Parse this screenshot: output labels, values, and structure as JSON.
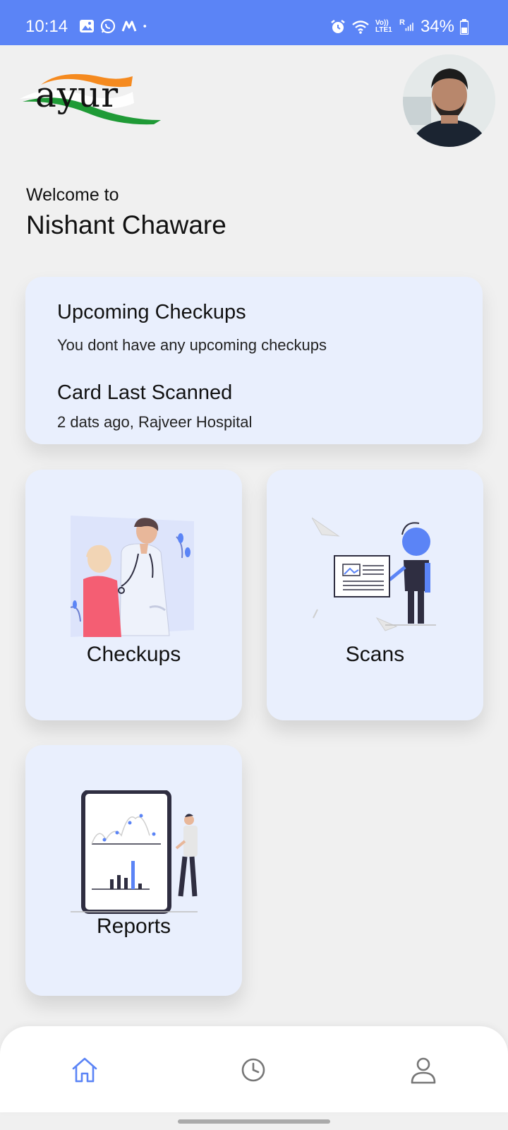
{
  "status_bar": {
    "time": "10:14",
    "battery": "34%",
    "left_icons": [
      "gallery-icon",
      "whatsapp-icon",
      "m-app-icon",
      "notification-dot-icon"
    ],
    "right_icons": [
      "alarm-icon",
      "wifi-icon",
      "volte-lte-icon",
      "signal-icon",
      "battery-icon"
    ],
    "network_label": "Vo)) LTE1",
    "roaming_label": "R",
    "color": "#5b84f6"
  },
  "header": {
    "logo_text": "ayur",
    "avatar": "profile-photo"
  },
  "welcome": {
    "line1": "Welcome to",
    "name": "Nishant Chaware"
  },
  "info_card": {
    "upcoming_title": "Upcoming Checkups",
    "upcoming_text": "You dont have any upcoming checkups",
    "scanned_title": "Card Last Scanned",
    "scanned_text": "2 dats ago, Rajveer Hospital"
  },
  "tiles": [
    {
      "label": "Checkups",
      "icon": "doctor-illustration"
    },
    {
      "label": "Scans",
      "icon": "scan-illustration"
    },
    {
      "label": "Reports",
      "icon": "report-illustration"
    }
  ],
  "bottom_nav": {
    "items": [
      {
        "icon": "home-icon",
        "active": true
      },
      {
        "icon": "clock-icon",
        "active": false
      },
      {
        "icon": "user-icon",
        "active": false
      }
    ],
    "active_color": "#5b84f6",
    "inactive_color": "#777777"
  },
  "colors": {
    "card_bg": "#e9effd",
    "accent": "#5b84f6"
  }
}
